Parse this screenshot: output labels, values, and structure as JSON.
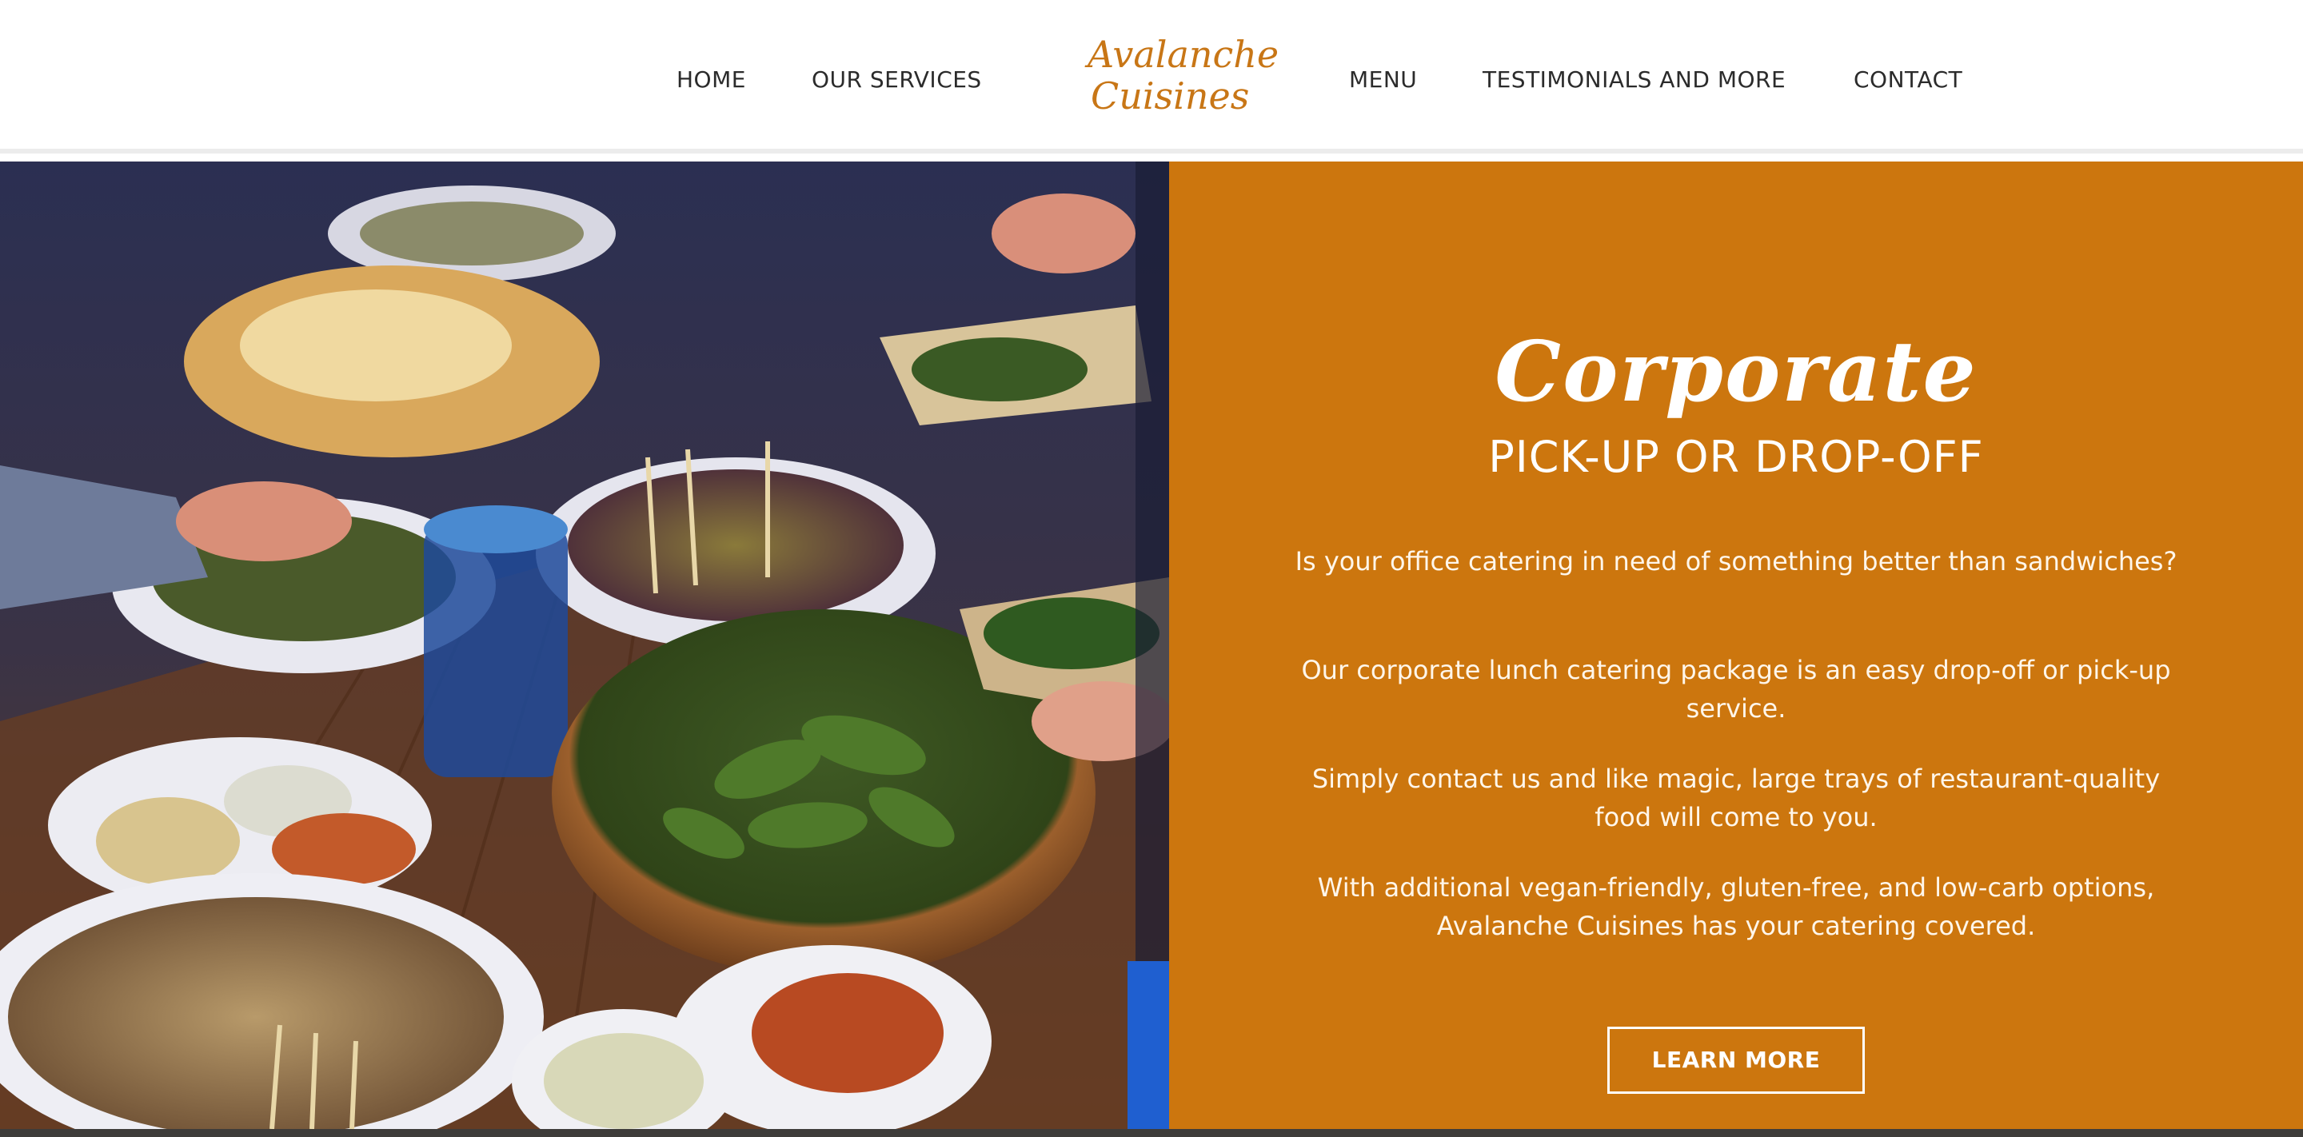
{
  "nav": {
    "home": "HOME",
    "services": "OUR SERVICES",
    "menu": "MENU",
    "testimonials": "TESTIMONIALS AND MORE",
    "contact": "CONTACT"
  },
  "logo": {
    "line1": "Avalanche",
    "line2": "Cuisines"
  },
  "hero": {
    "image_icon": "catering-buffet-photo"
  },
  "panel": {
    "script_title": "Corporate",
    "subtitle": "PICK-UP OR DROP-OFF",
    "paragraphs": [
      "Is your office catering in need of something better than sandwiches?",
      "Our corporate lunch catering package is an easy drop-off or pick-up service.",
      "Simply contact us and like magic, large trays of restaurant-quality food will come to you.",
      "With additional vegan-friendly, gluten-free, and low-carb options, Avalanche Cuisines has your catering covered."
    ],
    "button_label": "LEARN MORE"
  },
  "colors": {
    "accent": "#cc760e",
    "logo": "#c87616",
    "nav_text": "#2b2b2b"
  }
}
